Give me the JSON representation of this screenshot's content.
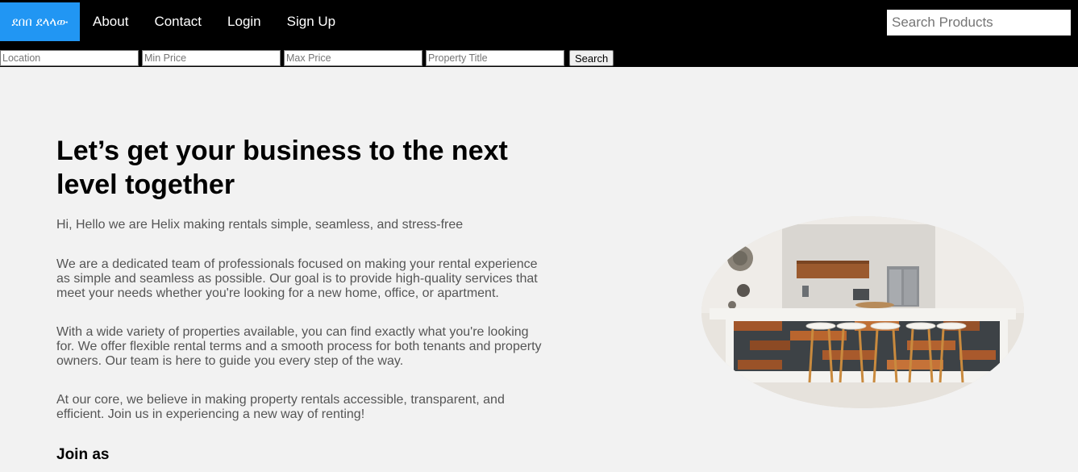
{
  "nav": {
    "brand": "ደበበ ደላላው",
    "links": [
      "About",
      "Contact",
      "Login",
      "Sign Up"
    ],
    "search_placeholder": "Search Products",
    "brand_color": "#2196f3",
    "background_color": "#000000"
  },
  "filters": {
    "location_placeholder": "Location",
    "min_price_placeholder": "Min Price",
    "max_price_placeholder": "Max Price",
    "title_placeholder": "Property Title",
    "search_label": "Search"
  },
  "hero": {
    "title": "Let’s get your business to the next level together",
    "intro": "Hi, Hello we are Helix making rentals simple, seamless, and stress-free",
    "paragraphs": [
      "We are a dedicated team of professionals focused on making your rental experience as simple and seamless as possible. Our goal is to provide high-quality services that meet your needs whether you're looking for a new home, office, or apartment.",
      "With a wide variety of properties available, you can find exactly what you're looking for. We offer flexible rental terms and a smooth process for both tenants and property owners. Our team is here to guide you every step of the way.",
      "At our core, we believe in making property rentals accessible, transparent, and efficient. Join us in experiencing a new way of renting!"
    ],
    "join_heading": "Join as",
    "image_icon": "kitchen-photo"
  }
}
